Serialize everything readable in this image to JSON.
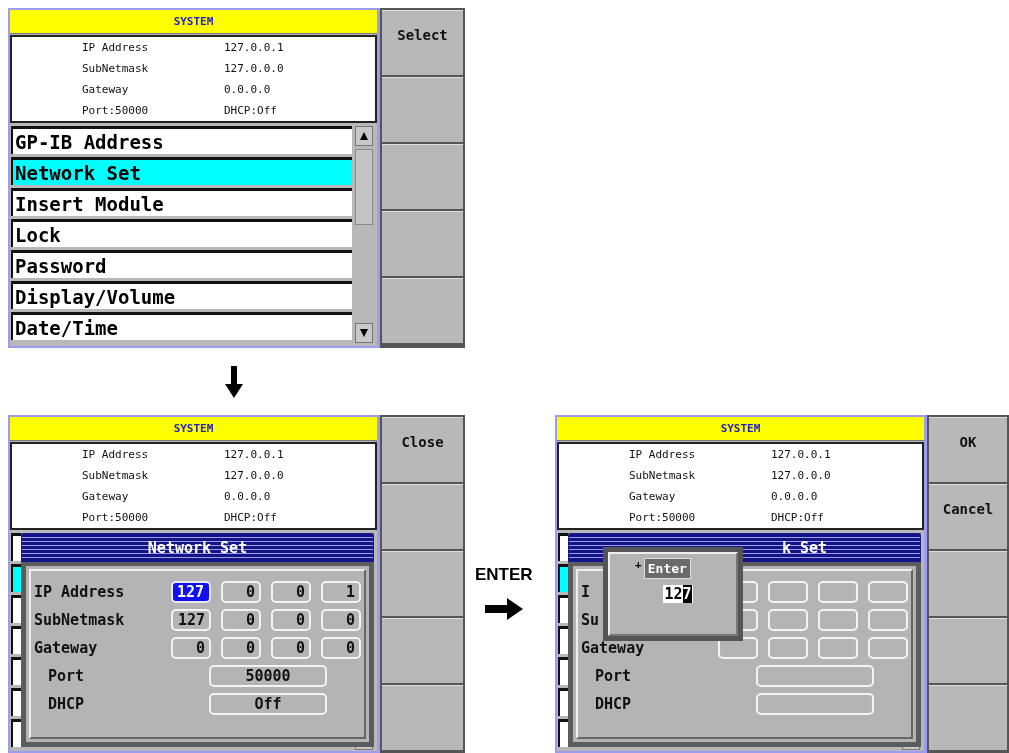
{
  "screens": [
    {
      "header": "SYSTEM",
      "info": [
        {
          "label": "IP Address",
          "value": "127.0.0.1"
        },
        {
          "label": "SubNetmask",
          "value": "127.0.0.0"
        },
        {
          "label": "Gateway",
          "value": "0.0.0.0"
        },
        {
          "label": "Port:50000",
          "value": "DHCP:Off"
        }
      ],
      "menu": [
        {
          "label": "GP-IB Address",
          "selected": false
        },
        {
          "label": "Network Set",
          "selected": true
        },
        {
          "label": "Insert Module",
          "selected": false
        },
        {
          "label": "Lock",
          "selected": false
        },
        {
          "label": "Password",
          "selected": false
        },
        {
          "label": "Display/Volume",
          "selected": false
        },
        {
          "label": "Date/Time",
          "selected": false
        }
      ],
      "softkeys": [
        {
          "kind": "labeled",
          "label": "Select"
        },
        {
          "kind": "blank"
        },
        {
          "kind": "blank"
        },
        {
          "kind": "blank"
        },
        {
          "kind": "blank"
        }
      ]
    },
    {
      "header": "SYSTEM",
      "info": [
        {
          "label": "IP Address",
          "value": "127.0.0.1"
        },
        {
          "label": "SubNetmask",
          "value": "127.0.0.0"
        },
        {
          "label": "Gateway",
          "value": "0.0.0.0"
        },
        {
          "label": "Port:50000",
          "value": "DHCP:Off"
        }
      ],
      "menu": [
        {
          "selected": false
        },
        {
          "selected": true
        },
        {
          "selected": false
        },
        {
          "selected": false
        },
        {
          "selected": false
        },
        {
          "selected": false
        },
        {
          "selected": false
        }
      ],
      "softkeys": [
        {
          "kind": "labeled",
          "label": "Close"
        },
        {
          "kind": "blank"
        },
        {
          "kind": "blank"
        },
        {
          "kind": "blank"
        },
        {
          "kind": "blank"
        }
      ],
      "dialog": {
        "title": "Network Set",
        "rows": [
          {
            "kind": "octets",
            "label": "IP Address",
            "fields": [
              {
                "value": "127",
                "selected": true
              },
              {
                "value": "0",
                "selected": false
              },
              {
                "value": "0",
                "selected": false
              },
              {
                "value": "1",
                "selected": false
              }
            ]
          },
          {
            "kind": "octets",
            "label": "SubNetmask",
            "fields": [
              {
                "value": "127",
                "selected": false
              },
              {
                "value": "0",
                "selected": false
              },
              {
                "value": "0",
                "selected": false
              },
              {
                "value": "0",
                "selected": false
              }
            ]
          },
          {
            "kind": "octets",
            "label": "Gateway",
            "fields": [
              {
                "value": "0",
                "selected": false
              },
              {
                "value": "0",
                "selected": false
              },
              {
                "value": "0",
                "selected": false
              },
              {
                "value": "0",
                "selected": false
              }
            ]
          },
          {
            "kind": "single",
            "label": "Port",
            "fields": [
              {
                "value": "50000",
                "selected": false
              }
            ]
          },
          {
            "kind": "single",
            "label": "DHCP",
            "fields": [
              {
                "value": "Off",
                "selected": false
              }
            ]
          }
        ]
      }
    },
    {
      "header": "SYSTEM",
      "info": [
        {
          "label": "IP Address",
          "value": "127.0.0.1"
        },
        {
          "label": "SubNetmask",
          "value": "127.0.0.0"
        },
        {
          "label": "Gateway",
          "value": "0.0.0.0"
        },
        {
          "label": "Port:50000",
          "value": "DHCP:Off"
        }
      ],
      "menu": [
        {
          "selected": false
        },
        {
          "selected": true
        },
        {
          "selected": false
        },
        {
          "selected": false
        },
        {
          "selected": false
        },
        {
          "selected": false
        },
        {
          "selected": false
        }
      ],
      "softkeys": [
        {
          "kind": "labeled",
          "label": "OK"
        },
        {
          "kind": "labeled",
          "label": "Cancel"
        },
        {
          "kind": "blank"
        },
        {
          "kind": "blank"
        },
        {
          "kind": "blank"
        }
      ],
      "dialog": {
        "title": "k Set",
        "rows": [
          {
            "kind": "octets",
            "label": "I",
            "fields": [
              {
                "selected": false
              },
              {
                "selected": false
              },
              {
                "selected": false
              },
              {
                "selected": false
              }
            ]
          },
          {
            "kind": "octets",
            "label": "Su",
            "fields": [
              {
                "selected": false
              },
              {
                "selected": false
              },
              {
                "selected": false
              },
              {
                "selected": false
              }
            ]
          },
          {
            "kind": "octets",
            "label": "Gateway",
            "fields": [
              {
                "selected": false
              },
              {
                "selected": false
              },
              {
                "selected": false
              },
              {
                "selected": false
              }
            ]
          },
          {
            "kind": "single",
            "label": "Port",
            "fields": [
              {
                "selected": false
              }
            ]
          },
          {
            "kind": "single",
            "label": "DHCP",
            "fields": [
              {
                "selected": false
              }
            ]
          }
        ],
        "popup": {
          "marker": "+",
          "title": "Enter",
          "value": "127",
          "cursor_at_end": true
        }
      }
    }
  ],
  "enter_caption": "ENTER"
}
